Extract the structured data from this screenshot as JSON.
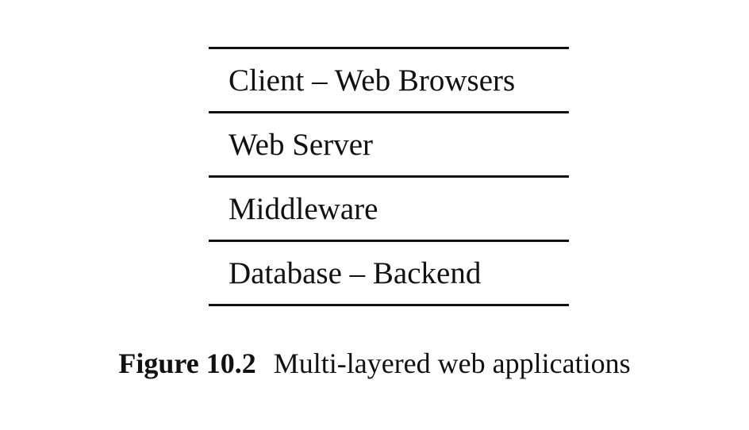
{
  "diagram": {
    "layers": [
      "Client – Web Browsers",
      "Web Server",
      "Middleware",
      "Database – Backend"
    ]
  },
  "caption": {
    "number": "Figure 10.2",
    "text": "Multi-layered web applications"
  }
}
